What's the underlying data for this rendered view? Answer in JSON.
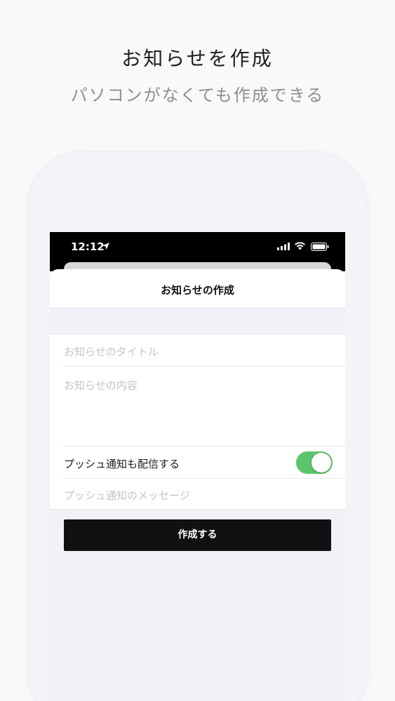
{
  "marketing": {
    "headline": "お知らせを作成",
    "subheadline": "パソコンがなくても作成できる"
  },
  "status_bar": {
    "time": "12:12",
    "icons": [
      "location-icon",
      "signal-icon",
      "wifi-icon",
      "battery-icon"
    ]
  },
  "nav": {
    "title": "お知らせの作成"
  },
  "form": {
    "title_placeholder": "お知らせのタイトル",
    "body_placeholder": "お知らせの内容",
    "push_label": "プッシュ通知も配信する",
    "push_enabled": true,
    "push_message_placeholder": "プッシュ通知のメッセージ"
  },
  "actions": {
    "create_label": "作成する"
  },
  "colors": {
    "toggle_on": "#5bc56b",
    "button_bg": "#111113",
    "placeholder": "#c4c4c8"
  }
}
